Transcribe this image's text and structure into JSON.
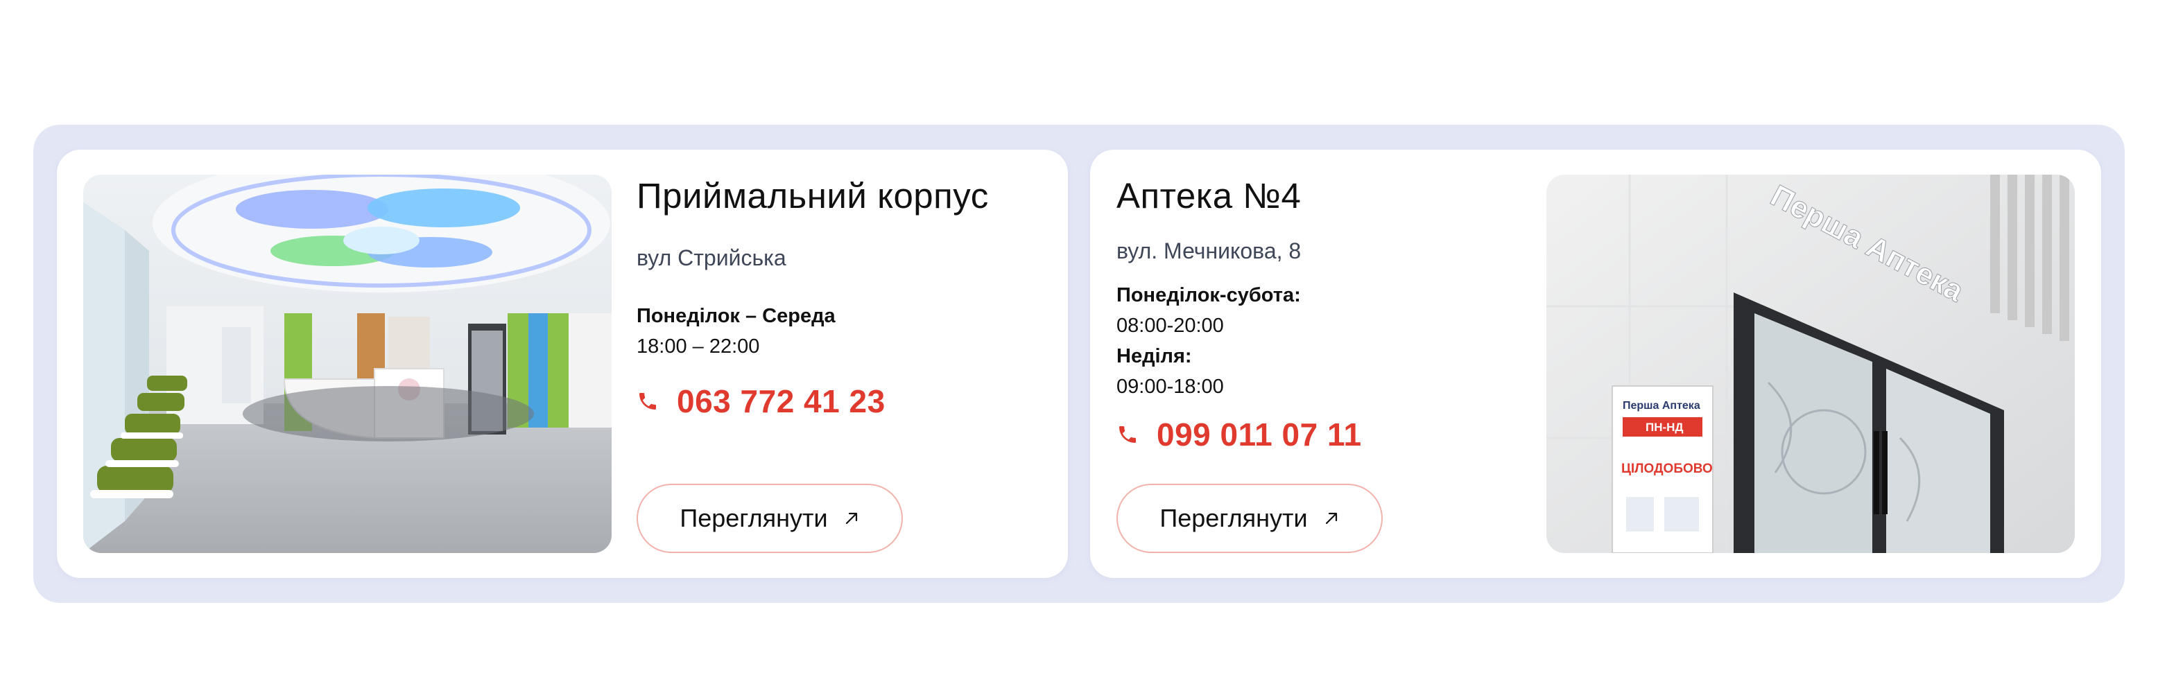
{
  "locations": [
    {
      "title": "Приймальний корпус",
      "address": "вул Стрийська",
      "hours": [
        {
          "label": "Понеділок – Середа",
          "value": "18:00 – 22:00"
        }
      ],
      "phone": "063 772 41 23",
      "button_label": "Переглянути",
      "photo_icon": "reception-hall-photo"
    },
    {
      "title": "Аптека №4",
      "address": "вул. Мечникова, 8",
      "hours": [
        {
          "label": "Понеділок-субота:",
          "value": "08:00-20:00"
        },
        {
          "label": "Неділя:",
          "value": "09:00-18:00"
        }
      ],
      "phone": "099 011 07 11",
      "button_label": "Переглянути",
      "photo_icon": "pharmacy-entrance-photo",
      "photo_sign": {
        "brand": "Перша Аптека",
        "poster_brand": "Перша Аптека",
        "poster_days": "ПН-НД",
        "poster_hours": "ЦІЛОДОБОВО"
      }
    }
  ],
  "colors": {
    "accent": "#e03a2f",
    "strip_background": "#e3e6f5",
    "card_background": "#ffffff",
    "button_border": "#f4b2ad",
    "address_text": "#3f4658"
  },
  "icons": {
    "phone": "phone-icon",
    "arrow": "arrow-up-right-icon"
  }
}
